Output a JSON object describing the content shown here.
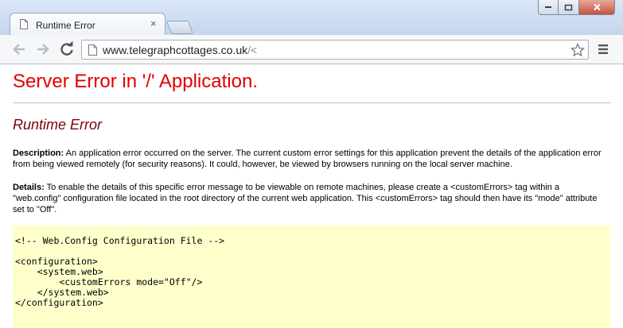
{
  "browser": {
    "tab": {
      "title": "Runtime Error",
      "close_glyph": "×"
    },
    "address_bar": {
      "host": "www.telegraphcottages.co.uk",
      "rest": "/<"
    },
    "colors": {
      "frame": "#c4d6ef",
      "close_button": "#c7513f"
    }
  },
  "page": {
    "heading": "Server Error in '/' Application.",
    "subheading": "Runtime Error",
    "description": {
      "label": "Description:",
      "text": " An application error occurred on the server. The current custom error settings for this application prevent the details of the application error from being viewed remotely (for security reasons). It could, however, be viewed by browsers running on the local server machine."
    },
    "details": {
      "label": "Details:",
      "text": " To enable the details of this specific error message to be viewable on remote machines, please create a <customErrors> tag within a \"web.config\" configuration file located in the root directory of the current web application. This <customErrors> tag should then have its \"mode\" attribute set to \"Off\"."
    },
    "code_lines": [
      "<!-- Web.Config Configuration File -->",
      "",
      "<configuration>",
      "    <system.web>",
      "        <customErrors mode=\"Off\"/>",
      "    </system.web>",
      "</configuration>"
    ],
    "colors": {
      "heading": "#e00000",
      "subheading": "#800000",
      "code_background": "#ffffcc"
    }
  }
}
